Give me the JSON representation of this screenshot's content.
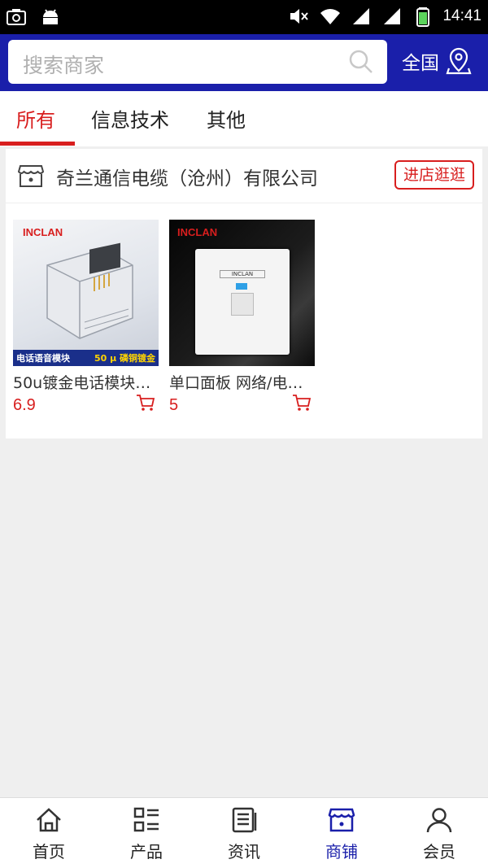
{
  "status_bar": {
    "time": "14:41"
  },
  "header": {
    "search_placeholder": "搜索商家",
    "region_label": "全国"
  },
  "tabs": [
    {
      "label": "所有",
      "active": true
    },
    {
      "label": "信息技术",
      "active": false
    },
    {
      "label": "其他",
      "active": false
    }
  ],
  "store": {
    "name": "奇兰通信电缆（沧州）有限公司",
    "visit_label": "进店逛逛",
    "products": [
      {
        "title": "50u镀金电话模块…",
        "price": "6.9",
        "brand": "INCLAN",
        "banner_left": "电话语音模块",
        "banner_right": "50 μ 磷铜镀金"
      },
      {
        "title": "单口面板 网络/电…",
        "price": "5",
        "brand": "INCLAN",
        "plate_label": "INCLAN"
      }
    ]
  },
  "bottom_nav": [
    {
      "label": "首页",
      "icon": "home-icon",
      "active": false
    },
    {
      "label": "产品",
      "icon": "grid-list-icon",
      "active": false
    },
    {
      "label": "资讯",
      "icon": "news-icon",
      "active": false
    },
    {
      "label": "商铺",
      "icon": "shop-icon",
      "active": true
    },
    {
      "label": "会员",
      "icon": "user-icon",
      "active": false
    }
  ],
  "colors": {
    "brand_blue": "#1a1faa",
    "accent_red": "#d81e1e"
  }
}
